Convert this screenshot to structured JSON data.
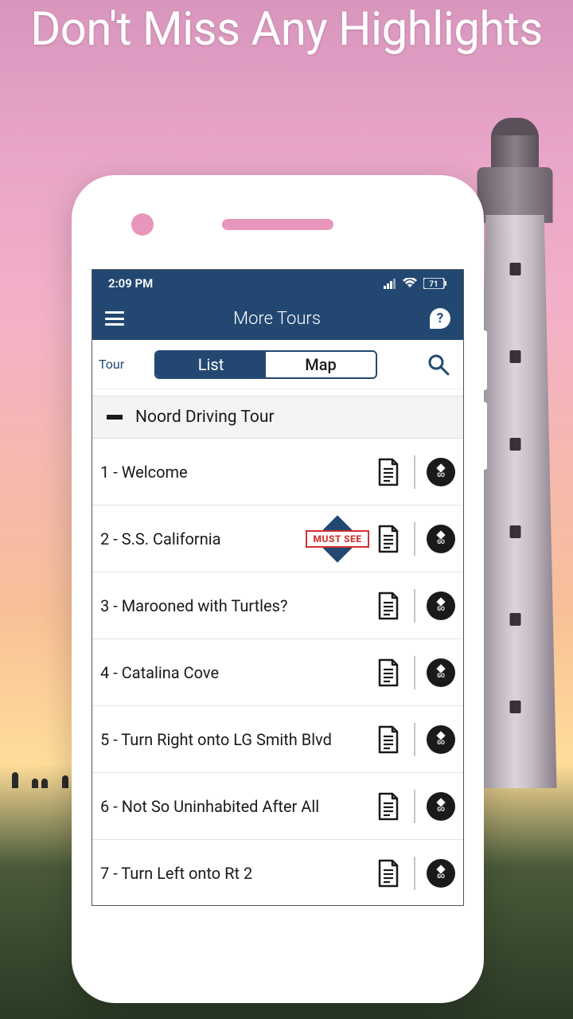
{
  "headline": "Don't Miss Any Highlights",
  "statusbar": {
    "time": "2:09 PM",
    "battery": "71"
  },
  "appbar": {
    "title": "More Tours",
    "help_label": "?"
  },
  "filter": {
    "tour_label": "Tour",
    "segments": {
      "list": "List",
      "map": "Map"
    }
  },
  "section": {
    "title": "Noord Driving Tour"
  },
  "must_see_label": "MUST SEE",
  "go_label": "GO",
  "items": [
    {
      "num": "1",
      "title": "Welcome",
      "must_see": false
    },
    {
      "num": "2",
      "title": "S.S. California",
      "must_see": true
    },
    {
      "num": "3",
      "title": "Marooned with Turtles?",
      "must_see": false
    },
    {
      "num": "4",
      "title": "Catalina Cove",
      "must_see": false
    },
    {
      "num": "5",
      "title": "Turn Right onto LG Smith Blvd",
      "must_see": false
    },
    {
      "num": "6",
      "title": "Not So Uninhabited After All",
      "must_see": false
    },
    {
      "num": "7",
      "title": "Turn Left onto Rt 2",
      "must_see": false
    }
  ]
}
